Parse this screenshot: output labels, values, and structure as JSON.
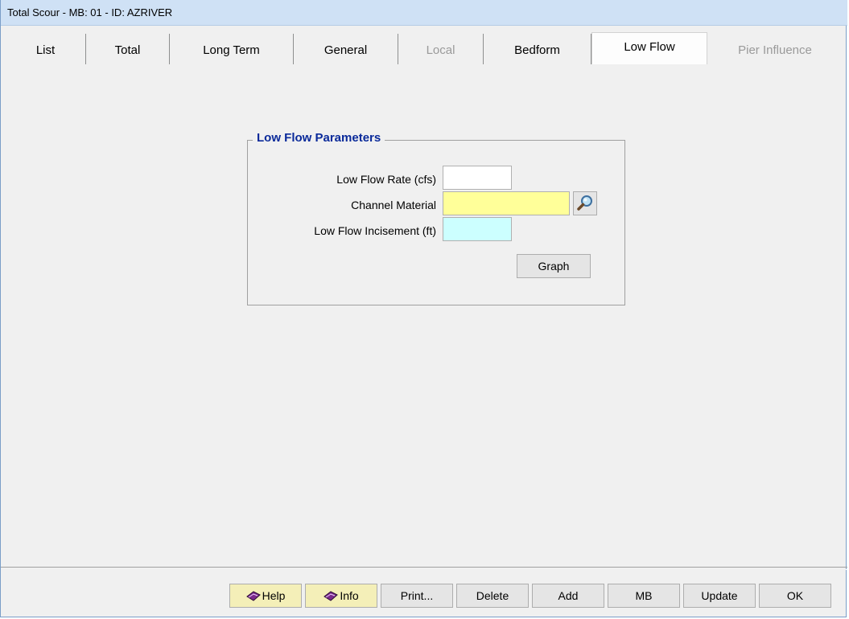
{
  "window": {
    "title": "Total Scour - MB: 01 - ID: AZRIVER"
  },
  "tabs": [
    {
      "label": "List",
      "state": "normal"
    },
    {
      "label": "Total",
      "state": "normal"
    },
    {
      "label": "Long Term",
      "state": "normal"
    },
    {
      "label": "General",
      "state": "normal"
    },
    {
      "label": "Local",
      "state": "disabled"
    },
    {
      "label": "Bedform",
      "state": "normal"
    },
    {
      "label": "Low Flow",
      "state": "active"
    },
    {
      "label": "Pier Influence",
      "state": "disabled"
    }
  ],
  "group": {
    "title": "Low Flow Parameters",
    "fields": {
      "rate": {
        "label": "Low Flow Rate (cfs)",
        "value": ""
      },
      "material": {
        "label": "Channel Material",
        "value": "",
        "bg": "#ffff99"
      },
      "incisement": {
        "label": "Low Flow Incisement (ft)",
        "value": "",
        "bg": "#ccffff"
      }
    },
    "graph_button": "Graph"
  },
  "buttons": {
    "help": "Help",
    "info": "Info",
    "print": "Print...",
    "delete": "Delete",
    "add": "Add",
    "mb": "MB",
    "update": "Update",
    "ok": "OK"
  },
  "icons": {
    "lookup": "magnifier-icon",
    "book": "book-icon"
  }
}
